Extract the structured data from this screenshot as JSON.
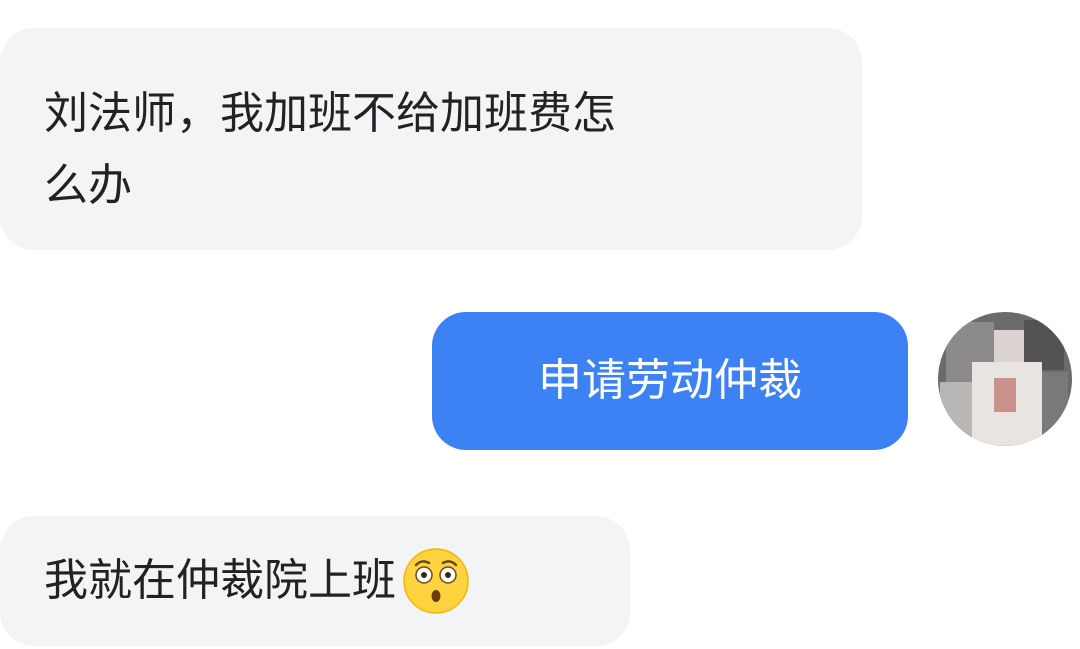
{
  "messages": [
    {
      "direction": "incoming",
      "text": "刘法师，我加班不给加班费怎\n么办"
    },
    {
      "direction": "outgoing",
      "text": "申请劳动仲裁"
    },
    {
      "direction": "incoming",
      "text": "我就在仲裁院上班",
      "emoji": "astonished-face-emoji"
    }
  ],
  "avatar": {
    "icon": "blurred-user-avatar"
  },
  "colors": {
    "incoming_bubble": "#f3f4f6",
    "outgoing_bubble": "#3d82f5",
    "incoming_text": "#222222",
    "outgoing_text": "#ffffff",
    "background": "#ffffff"
  }
}
